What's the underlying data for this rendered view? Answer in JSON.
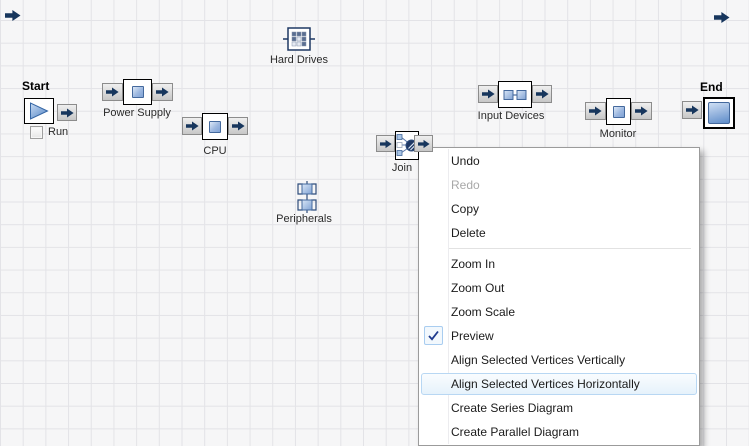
{
  "canvas": {
    "background": "#f6f6f7",
    "grid_color": "#e3e3e7"
  },
  "colors": {
    "arrow_glyph": "#17365d",
    "node_border": "#000000",
    "blue_fill_light": "#dce8f7",
    "blue_fill_dark": "#7fa2d4",
    "menu_highlight_border": "#b8d7f3",
    "menu_highlight_fill": "#e6f2fb",
    "check_navy": "#1e3b8e"
  },
  "icons": {
    "arrow": "right-arrow-icon",
    "play": "play-icon",
    "hard_drives": "drive-grid-icon",
    "peripherals": "series-component-icon",
    "join": "merge-icon",
    "input_devices": "two-block-icon",
    "end_block": "block-icon",
    "check": "checkmark-icon"
  },
  "nodes": {
    "start": {
      "label": "Start",
      "run_label": "Run"
    },
    "power_supply": {
      "label": "Power Supply"
    },
    "cpu": {
      "label": "CPU"
    },
    "hard_drives": {
      "label": "Hard Drives"
    },
    "peripherals": {
      "label": "Peripherals"
    },
    "join": {
      "label": "Join"
    },
    "input_devices": {
      "label": "Input Devices"
    },
    "monitor": {
      "label": "Monitor"
    },
    "end": {
      "label": "End"
    }
  },
  "context_menu": {
    "items": [
      {
        "label": "Undo"
      },
      {
        "label": "Redo",
        "disabled": true
      },
      {
        "label": "Copy"
      },
      {
        "label": "Delete"
      },
      {
        "separator": true
      },
      {
        "label": "Zoom In"
      },
      {
        "label": "Zoom Out"
      },
      {
        "label": "Zoom Scale"
      },
      {
        "label": "Preview",
        "checked": true
      },
      {
        "label": "Align Selected Vertices Vertically"
      },
      {
        "label": "Align Selected Vertices Horizontally",
        "highlighted": true
      },
      {
        "label": "Create Series Diagram"
      },
      {
        "label": "Create Parallel Diagram"
      }
    ]
  }
}
